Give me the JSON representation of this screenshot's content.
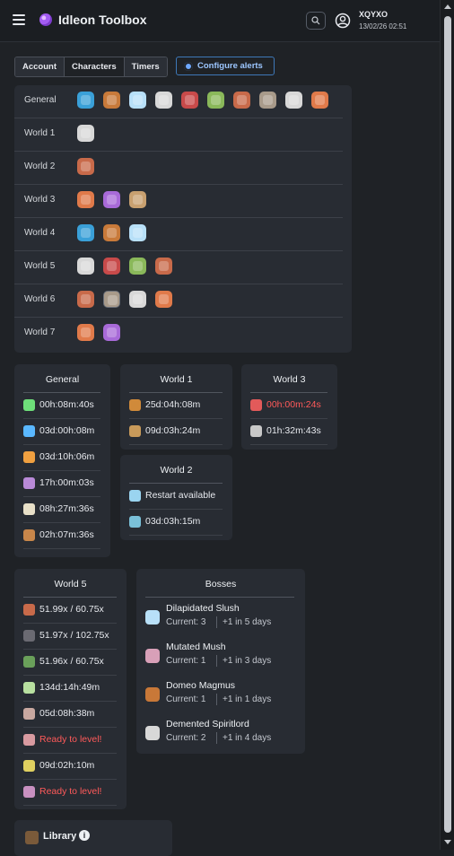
{
  "header": {
    "brand": "Idleon Toolbox",
    "username": "XQYXO",
    "datetime": "13/02/26 02:51"
  },
  "tabs": [
    {
      "label": "Account",
      "active": false
    },
    {
      "label": "Characters",
      "active": true
    },
    {
      "label": "Timers",
      "active": false
    }
  ],
  "configure_alerts": {
    "label": "Configure alerts"
  },
  "worlds": [
    {
      "label": "General",
      "icons": [
        "orb-icon",
        "slug-icon",
        "ice-monster-icon",
        "ghost-icon",
        "mage-icon",
        "plant-icon",
        "warrior-icon",
        "rock-icon",
        "archer-icon",
        "fish-icon"
      ]
    },
    {
      "label": "World 1",
      "icons": [
        "drum-icon"
      ]
    },
    {
      "label": "World 2",
      "icons": [
        "bottle-icon"
      ]
    },
    {
      "label": "World 3",
      "icons": [
        "crystal-icon",
        "shrine-icon",
        "box-icon"
      ]
    },
    {
      "label": "World 4",
      "icons": [
        "goblin-icon",
        "chomper-icon",
        "cat-icon"
      ]
    },
    {
      "label": "World 5",
      "icons": [
        "campfire-icon",
        "knight-icon",
        "squirrel-icon",
        "fairy-icon"
      ]
    },
    {
      "label": "World 6",
      "icons": [
        "farm-icon",
        "beast-icon",
        "summon-icon",
        "shadow-icon"
      ]
    },
    {
      "label": "World 7",
      "icons": [
        "scroll-icon",
        "bat-icon"
      ]
    }
  ],
  "general_timers": {
    "title": "General",
    "rows": [
      {
        "value": "00h:08m:40s",
        "icon": "letter-d-icon",
        "color": "#6ee07a"
      },
      {
        "value": "03d:00h:08m",
        "icon": "letter-w-icon",
        "color": "#5ab8ff"
      },
      {
        "value": "03d:10h:06m",
        "icon": "fox-icon",
        "color": "#f0a040"
      },
      {
        "value": "17h:00m:03s",
        "icon": "sprite-icon",
        "color": "#b98ad8"
      },
      {
        "value": "08h:27m:36s",
        "icon": "skulls-icon",
        "color": "#e8e0c8"
      },
      {
        "value": "02h:07m:36s",
        "icon": "slug-icon",
        "color": "#c8864a"
      }
    ]
  },
  "world1_timers": {
    "title": "World 1",
    "rows": [
      {
        "value": "25d:04h:08m",
        "icon": "gear-clock-icon",
        "color": "#d08a3a"
      },
      {
        "value": "09d:03h:24m",
        "icon": "mask-icon",
        "color": "#c89a5a"
      }
    ]
  },
  "world3_timers": {
    "title": "World 3",
    "rows": [
      {
        "value": "00h:00m:24s",
        "icon": "crystal-icon",
        "color": "#e25a5a",
        "alert": true
      },
      {
        "value": "01h:32m:43s",
        "icon": "hand-icon",
        "color": "#c8c8c8"
      }
    ]
  },
  "world2_timers": {
    "title": "World 2",
    "rows": [
      {
        "value": "Restart available",
        "icon": "eye-icon",
        "color": "#9ad4f0"
      },
      {
        "value": "03d:03h:15m",
        "icon": "wings-icon",
        "color": "#7ac0d8"
      }
    ]
  },
  "world5_timers": {
    "title": "World 5",
    "rows": [
      {
        "value": "51.99x / 60.75x",
        "icon": "knight-red-icon",
        "color": "#c86a4a"
      },
      {
        "value": "51.97x / 102.75x",
        "icon": "knight-dark-icon",
        "color": "#6a6a72"
      },
      {
        "value": "51.96x / 60.75x",
        "icon": "knight-green-icon",
        "color": "#6aa05a"
      },
      {
        "value": "134d:14h:49m",
        "icon": "ghost-green-icon",
        "color": "#b8e0a0"
      },
      {
        "value": "05d:08h:38m",
        "icon": "elf-icon",
        "color": "#c8a8a0"
      },
      {
        "value": "Ready to level!",
        "icon": "pet-icon",
        "color": "#d89aa0",
        "alert": true
      },
      {
        "value": "09d:02h:10m",
        "icon": "mushroom-icon",
        "color": "#e0d060"
      },
      {
        "value": "Ready to level!",
        "icon": "fairy-icon",
        "color": "#c890c0",
        "alert": true
      }
    ]
  },
  "bosses": {
    "title": "Bosses",
    "items": [
      {
        "name": "Dilapidated Slush",
        "current": "Current: 3",
        "next": "+1 in 5 days",
        "icon": "slush-icon",
        "color": "#b8e0f8"
      },
      {
        "name": "Mutated Mush",
        "current": "Current: 1",
        "next": "+1 in 3 days",
        "icon": "mush-icon",
        "color": "#d8a0b8"
      },
      {
        "name": "Domeo Magmus",
        "current": "Current: 1",
        "next": "+1 in 1 days",
        "icon": "magmus-icon",
        "color": "#c87838"
      },
      {
        "name": "Demented Spiritlord",
        "current": "Current: 2",
        "next": "+1 in 4 days",
        "icon": "spiritlord-icon",
        "color": "#d8d8d8"
      }
    ]
  },
  "library": {
    "label": "Library",
    "icon": "library-icon"
  }
}
